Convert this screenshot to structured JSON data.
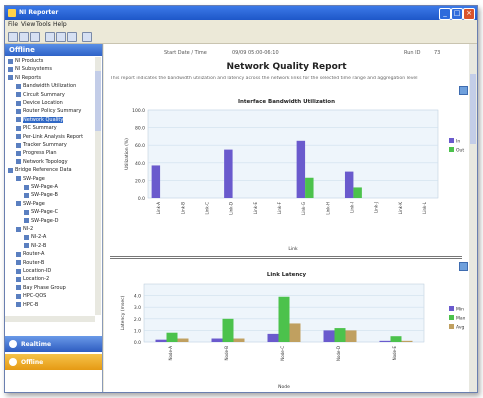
{
  "window": {
    "title": "NI Reporter",
    "min": "_",
    "max": "□",
    "close": "×"
  },
  "menu": [
    "File",
    "View",
    "Tools",
    "Help"
  ],
  "left_pane": {
    "header": "Offline",
    "tree": [
      {
        "label": "NI Products",
        "indent": 0
      },
      {
        "label": "NI Subsystems",
        "indent": 0
      },
      {
        "label": "NI Reports",
        "indent": 0
      },
      {
        "label": "Bandwidth Utilization",
        "indent": 1
      },
      {
        "label": "Circuit Summary",
        "indent": 1
      },
      {
        "label": "Device Location",
        "indent": 1
      },
      {
        "label": "Router Policy Summary",
        "indent": 1
      },
      {
        "label": "Network Quality",
        "indent": 1,
        "selected": true
      },
      {
        "label": "PIC Summary",
        "indent": 1
      },
      {
        "label": "Per-Link Analysis Report",
        "indent": 1
      },
      {
        "label": "Tracker Summary",
        "indent": 1
      },
      {
        "label": "Progress Plan",
        "indent": 1
      },
      {
        "label": "Network Topology",
        "indent": 1
      },
      {
        "label": "Bridge Reference Data",
        "indent": 0
      },
      {
        "label": "SW-Page",
        "indent": 1
      },
      {
        "label": "SW-Page-A",
        "indent": 2
      },
      {
        "label": "SW-Page-B",
        "indent": 2
      },
      {
        "label": "SW-Page",
        "indent": 1
      },
      {
        "label": "SW-Page-C",
        "indent": 2
      },
      {
        "label": "SW-Page-D",
        "indent": 2
      },
      {
        "label": "NI-2",
        "indent": 1
      },
      {
        "label": "NI-2-A",
        "indent": 2
      },
      {
        "label": "NI-2-B",
        "indent": 2
      },
      {
        "label": "Router-A",
        "indent": 1
      },
      {
        "label": "Router-B",
        "indent": 1
      },
      {
        "label": "Location-ID",
        "indent": 1
      },
      {
        "label": "Location-2",
        "indent": 1
      },
      {
        "label": "Bay Phase Group",
        "indent": 1
      },
      {
        "label": "HPC-QOS",
        "indent": 1
      },
      {
        "label": "HPC-B",
        "indent": 1
      }
    ],
    "nav_buttons": [
      "Realtime",
      "Offline"
    ]
  },
  "report": {
    "header_left": "Start Date / Time",
    "header_mid": "09/09 05:00-06:10",
    "header_right": "Run ID",
    "header_right_value": "73",
    "title": "Network Quality Report",
    "description": "This report indicates the bandwidth utilization and latency across the network links for the selected time range and aggregation level"
  },
  "chart_data": [
    {
      "type": "bar",
      "title": "Interface Bandwidth Utilization",
      "ylabel": "Utilization (%)",
      "xlabel": "Link",
      "ylim": [
        0,
        100
      ],
      "yticks": [
        "100.0",
        "80.0",
        "60.0",
        "40.0",
        "20.0",
        "0.0"
      ],
      "categories": [
        "Link-A",
        "Link-B",
        "Link-C",
        "Link-D",
        "Link-E",
        "Link-F",
        "Link-G",
        "Link-H",
        "Link-I",
        "Link-J",
        "Link-K",
        "Link-L"
      ],
      "series": [
        {
          "name": "In",
          "color": "#6a5acd",
          "values": [
            37,
            0,
            0,
            55,
            0,
            0,
            65,
            0,
            30,
            0,
            0,
            0
          ]
        },
        {
          "name": "Out",
          "color": "#4cc24c",
          "values": [
            0,
            0,
            0,
            0,
            0,
            0,
            23,
            0,
            12,
            0,
            0,
            0
          ]
        }
      ]
    },
    {
      "type": "bar",
      "title": "Link Latency",
      "ylabel": "Latency (msec)",
      "xlabel": "Node",
      "ylim": [
        0,
        5
      ],
      "yticks": [
        "4.0",
        "3.0",
        "2.0",
        "1.0",
        "0.0"
      ],
      "categories": [
        "Node-A",
        "Node-B",
        "Node-C",
        "Node-D",
        "Node-E"
      ],
      "series": [
        {
          "name": "Min",
          "color": "#6a5acd",
          "values": [
            0.2,
            0.3,
            0.7,
            1.0,
            0.1
          ]
        },
        {
          "name": "Max",
          "color": "#4cc24c",
          "values": [
            0.8,
            2.0,
            3.9,
            1.2,
            0.5
          ]
        },
        {
          "name": "Avg",
          "color": "#c0a060",
          "values": [
            0.3,
            0.3,
            1.6,
            1.0,
            0.1
          ]
        }
      ]
    }
  ]
}
